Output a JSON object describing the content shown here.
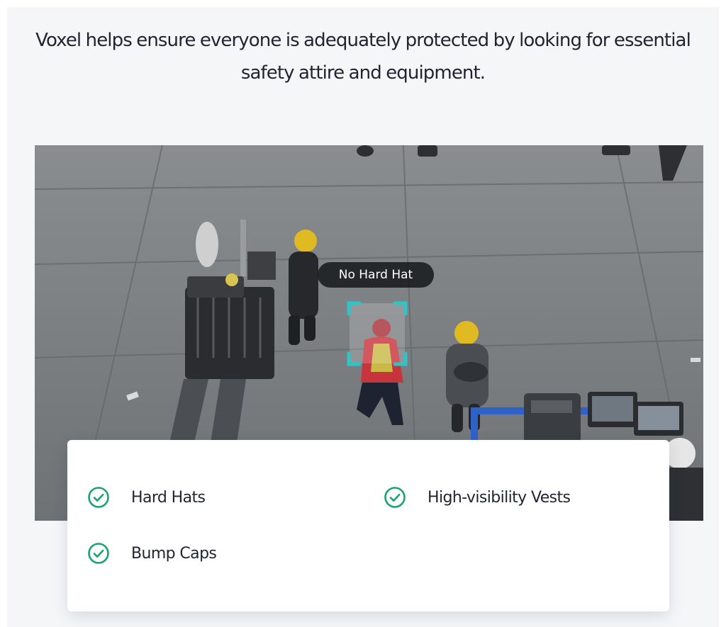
{
  "intro": {
    "text": "Voxel helps ensure everyone is adequately protected by looking for essential safety attire and equipment."
  },
  "detection": {
    "label": "No Hard Hat",
    "box_color": "#2cc6c8"
  },
  "features": [
    {
      "label": "Hard Hats",
      "icon": "check-circle-icon"
    },
    {
      "label": "High-visibility Vests",
      "icon": "check-circle-icon"
    },
    {
      "label": "Bump Caps",
      "icon": "check-circle-icon"
    }
  ],
  "colors": {
    "check": "#1aa36f",
    "text": "#1f2430",
    "panel": "#f4f6f8"
  }
}
